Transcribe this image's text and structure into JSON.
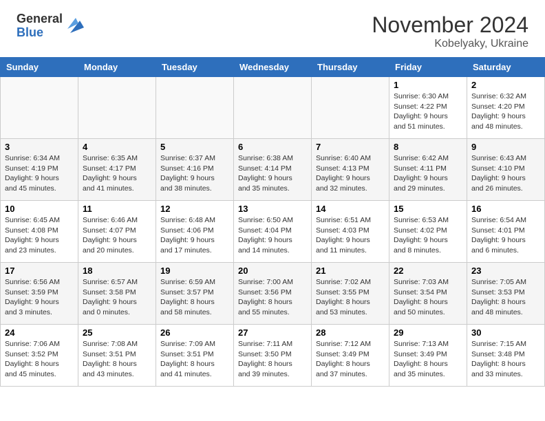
{
  "logo": {
    "general": "General",
    "blue": "Blue"
  },
  "header": {
    "month": "November 2024",
    "location": "Kobelyaky, Ukraine"
  },
  "weekdays": [
    "Sunday",
    "Monday",
    "Tuesday",
    "Wednesday",
    "Thursday",
    "Friday",
    "Saturday"
  ],
  "weeks": [
    {
      "days": [
        {
          "num": "",
          "info": ""
        },
        {
          "num": "",
          "info": ""
        },
        {
          "num": "",
          "info": ""
        },
        {
          "num": "",
          "info": ""
        },
        {
          "num": "",
          "info": ""
        },
        {
          "num": "1",
          "info": "Sunrise: 6:30 AM\nSunset: 4:22 PM\nDaylight: 9 hours\nand 51 minutes."
        },
        {
          "num": "2",
          "info": "Sunrise: 6:32 AM\nSunset: 4:20 PM\nDaylight: 9 hours\nand 48 minutes."
        }
      ]
    },
    {
      "days": [
        {
          "num": "3",
          "info": "Sunrise: 6:34 AM\nSunset: 4:19 PM\nDaylight: 9 hours\nand 45 minutes."
        },
        {
          "num": "4",
          "info": "Sunrise: 6:35 AM\nSunset: 4:17 PM\nDaylight: 9 hours\nand 41 minutes."
        },
        {
          "num": "5",
          "info": "Sunrise: 6:37 AM\nSunset: 4:16 PM\nDaylight: 9 hours\nand 38 minutes."
        },
        {
          "num": "6",
          "info": "Sunrise: 6:38 AM\nSunset: 4:14 PM\nDaylight: 9 hours\nand 35 minutes."
        },
        {
          "num": "7",
          "info": "Sunrise: 6:40 AM\nSunset: 4:13 PM\nDaylight: 9 hours\nand 32 minutes."
        },
        {
          "num": "8",
          "info": "Sunrise: 6:42 AM\nSunset: 4:11 PM\nDaylight: 9 hours\nand 29 minutes."
        },
        {
          "num": "9",
          "info": "Sunrise: 6:43 AM\nSunset: 4:10 PM\nDaylight: 9 hours\nand 26 minutes."
        }
      ]
    },
    {
      "days": [
        {
          "num": "10",
          "info": "Sunrise: 6:45 AM\nSunset: 4:08 PM\nDaylight: 9 hours\nand 23 minutes."
        },
        {
          "num": "11",
          "info": "Sunrise: 6:46 AM\nSunset: 4:07 PM\nDaylight: 9 hours\nand 20 minutes."
        },
        {
          "num": "12",
          "info": "Sunrise: 6:48 AM\nSunset: 4:06 PM\nDaylight: 9 hours\nand 17 minutes."
        },
        {
          "num": "13",
          "info": "Sunrise: 6:50 AM\nSunset: 4:04 PM\nDaylight: 9 hours\nand 14 minutes."
        },
        {
          "num": "14",
          "info": "Sunrise: 6:51 AM\nSunset: 4:03 PM\nDaylight: 9 hours\nand 11 minutes."
        },
        {
          "num": "15",
          "info": "Sunrise: 6:53 AM\nSunset: 4:02 PM\nDaylight: 9 hours\nand 8 minutes."
        },
        {
          "num": "16",
          "info": "Sunrise: 6:54 AM\nSunset: 4:01 PM\nDaylight: 9 hours\nand 6 minutes."
        }
      ]
    },
    {
      "days": [
        {
          "num": "17",
          "info": "Sunrise: 6:56 AM\nSunset: 3:59 PM\nDaylight: 9 hours\nand 3 minutes."
        },
        {
          "num": "18",
          "info": "Sunrise: 6:57 AM\nSunset: 3:58 PM\nDaylight: 9 hours\nand 0 minutes."
        },
        {
          "num": "19",
          "info": "Sunrise: 6:59 AM\nSunset: 3:57 PM\nDaylight: 8 hours\nand 58 minutes."
        },
        {
          "num": "20",
          "info": "Sunrise: 7:00 AM\nSunset: 3:56 PM\nDaylight: 8 hours\nand 55 minutes."
        },
        {
          "num": "21",
          "info": "Sunrise: 7:02 AM\nSunset: 3:55 PM\nDaylight: 8 hours\nand 53 minutes."
        },
        {
          "num": "22",
          "info": "Sunrise: 7:03 AM\nSunset: 3:54 PM\nDaylight: 8 hours\nand 50 minutes."
        },
        {
          "num": "23",
          "info": "Sunrise: 7:05 AM\nSunset: 3:53 PM\nDaylight: 8 hours\nand 48 minutes."
        }
      ]
    },
    {
      "days": [
        {
          "num": "24",
          "info": "Sunrise: 7:06 AM\nSunset: 3:52 PM\nDaylight: 8 hours\nand 45 minutes."
        },
        {
          "num": "25",
          "info": "Sunrise: 7:08 AM\nSunset: 3:51 PM\nDaylight: 8 hours\nand 43 minutes."
        },
        {
          "num": "26",
          "info": "Sunrise: 7:09 AM\nSunset: 3:51 PM\nDaylight: 8 hours\nand 41 minutes."
        },
        {
          "num": "27",
          "info": "Sunrise: 7:11 AM\nSunset: 3:50 PM\nDaylight: 8 hours\nand 39 minutes."
        },
        {
          "num": "28",
          "info": "Sunrise: 7:12 AM\nSunset: 3:49 PM\nDaylight: 8 hours\nand 37 minutes."
        },
        {
          "num": "29",
          "info": "Sunrise: 7:13 AM\nSunset: 3:49 PM\nDaylight: 8 hours\nand 35 minutes."
        },
        {
          "num": "30",
          "info": "Sunrise: 7:15 AM\nSunset: 3:48 PM\nDaylight: 8 hours\nand 33 minutes."
        }
      ]
    }
  ]
}
